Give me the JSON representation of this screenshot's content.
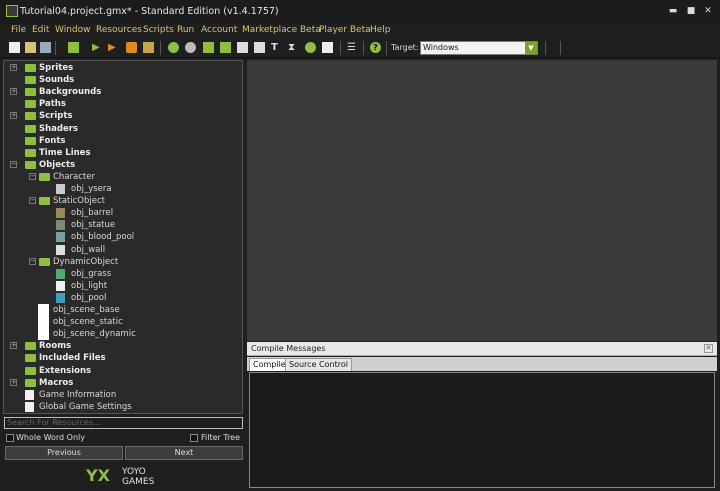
{
  "window": {
    "title": "Tutorial04.project.gmx*  -  Standard Edition (v1.4.1757)",
    "controls": [
      "minimize-icon",
      "maximize-icon",
      "close-icon"
    ]
  },
  "menu": [
    "File",
    "Edit",
    "Window",
    "Resources",
    "Scripts",
    "Run",
    "Account",
    "Marketplace Beta",
    "Player Beta",
    "Help"
  ],
  "toolbar": {
    "target_label": "Target:",
    "target_value": "Windows"
  },
  "tree": [
    {
      "label": "Sprites",
      "level": 0,
      "bold": true,
      "expander": "+"
    },
    {
      "label": "Sounds",
      "level": 0,
      "bold": true,
      "expander": ""
    },
    {
      "label": "Backgrounds",
      "level": 0,
      "bold": true,
      "expander": "+"
    },
    {
      "label": "Paths",
      "level": 0,
      "bold": true,
      "expander": ""
    },
    {
      "label": "Scripts",
      "level": 0,
      "bold": true,
      "expander": "+"
    },
    {
      "label": "Shaders",
      "level": 0,
      "bold": true,
      "expander": ""
    },
    {
      "label": "Fonts",
      "level": 0,
      "bold": true,
      "expander": ""
    },
    {
      "label": "Time Lines",
      "level": 0,
      "bold": true,
      "expander": ""
    },
    {
      "label": "Objects",
      "level": 0,
      "bold": true,
      "expander": "−"
    },
    {
      "label": "Character",
      "level": 1,
      "bold": false,
      "expander": "−",
      "icon": "folder"
    },
    {
      "label": "obj_ysera",
      "level": 2,
      "bold": false,
      "icon": "character-sprite-icon"
    },
    {
      "label": "StaticObject",
      "level": 1,
      "bold": false,
      "expander": "−",
      "icon": "folder"
    },
    {
      "label": "obj_barrel",
      "level": 2,
      "bold": false,
      "icon": "barrel-sprite-icon"
    },
    {
      "label": "obj_statue",
      "level": 2,
      "bold": false,
      "icon": "statue-sprite-icon"
    },
    {
      "label": "obj_blood_pool",
      "level": 2,
      "bold": false,
      "icon": "blood-pool-sprite-icon"
    },
    {
      "label": "obj_wall",
      "level": 2,
      "bold": false,
      "icon": "wall-sprite-icon"
    },
    {
      "label": "DynamicObject",
      "level": 1,
      "bold": false,
      "expander": "−",
      "icon": "folder"
    },
    {
      "label": "obj_grass",
      "level": 2,
      "bold": false,
      "icon": "grass-sprite-icon"
    },
    {
      "label": "obj_light",
      "level": 2,
      "bold": false,
      "icon": "light-sprite-icon"
    },
    {
      "label": "obj_pool",
      "level": 2,
      "bold": false,
      "icon": "pool-sprite-icon"
    },
    {
      "label": "obj_scene_base",
      "level": 1,
      "bold": false,
      "icon": "blank-sprite-icon"
    },
    {
      "label": "obj_scene_static",
      "level": 1,
      "bold": false,
      "icon": "blank-sprite-icon"
    },
    {
      "label": "obj_scene_dynamic",
      "level": 1,
      "bold": false,
      "icon": "blank-sprite-icon"
    },
    {
      "label": "Rooms",
      "level": 0,
      "bold": true,
      "expander": "+"
    },
    {
      "label": "Included Files",
      "level": 0,
      "bold": true,
      "expander": ""
    },
    {
      "label": "Extensions",
      "level": 0,
      "bold": true,
      "expander": ""
    },
    {
      "label": "Macros",
      "level": 0,
      "bold": true,
      "expander": "+"
    },
    {
      "label": "Game Information",
      "level": 0,
      "bold": false,
      "icon": "info-icon"
    },
    {
      "label": "Global Game Settings",
      "level": 0,
      "bold": false,
      "icon": "settings-check-icon"
    }
  ],
  "search": {
    "placeholder": "Search For Resources..."
  },
  "options": {
    "whole_word": "Whole Word Only",
    "filter_tree": "Filter Tree"
  },
  "nav": {
    "previous": "Previous",
    "next": "Next"
  },
  "logo": {
    "line1": "YOYO",
    "line2": "GAMES"
  },
  "compile": {
    "title": "Compile Messages",
    "tabs": [
      "Compile",
      "Source Control"
    ]
  },
  "colors": {
    "accent": "#8fbf3f",
    "menu_text": "#d9c27a",
    "panel_bg": "#2a2a2a"
  }
}
